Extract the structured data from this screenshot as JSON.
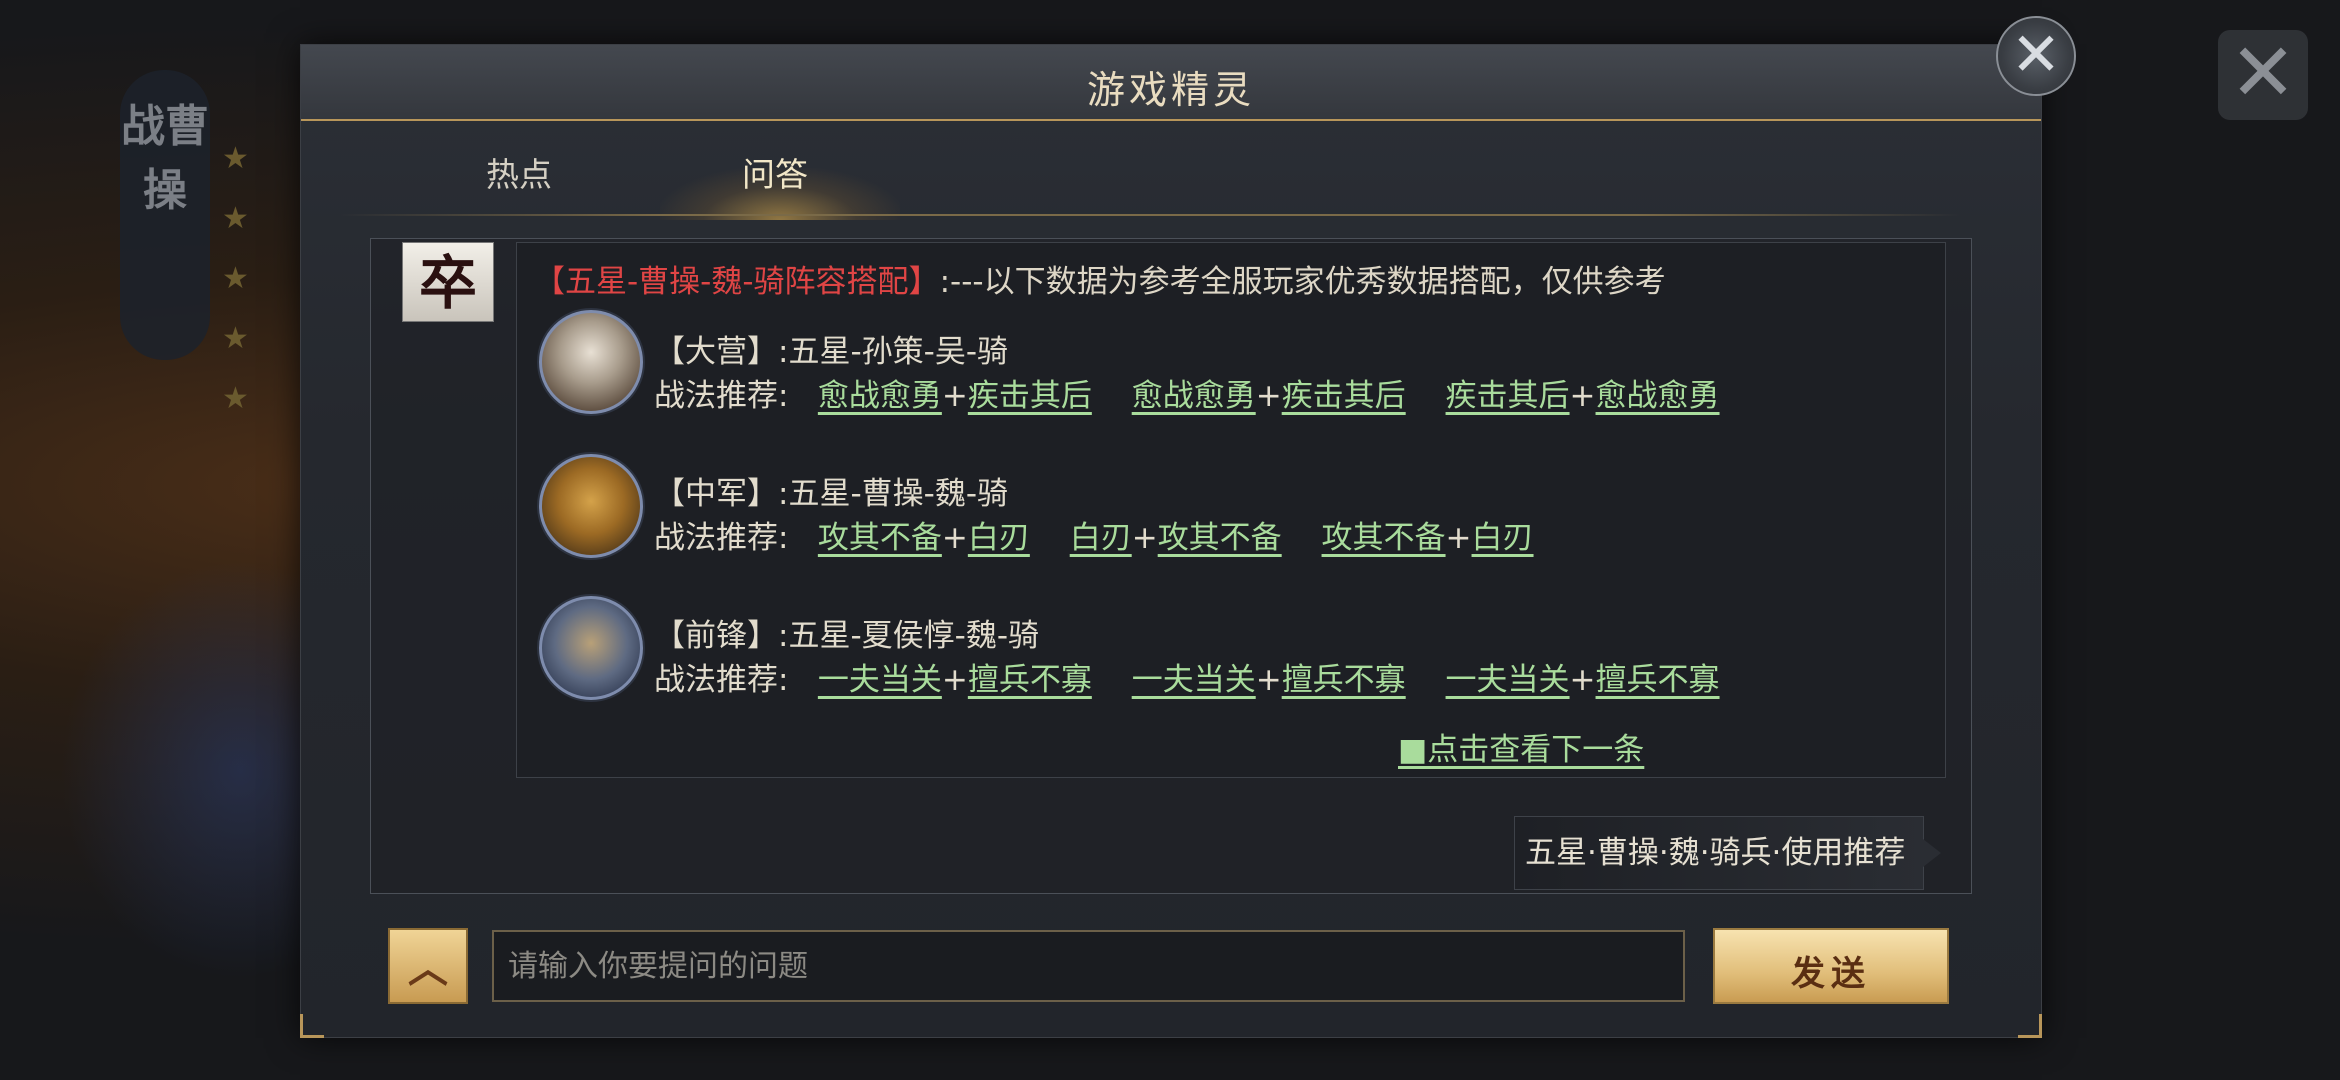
{
  "background": {
    "banner_text": "战曹操",
    "stars": [
      "★",
      "★",
      "★",
      "★",
      "★"
    ]
  },
  "dialog": {
    "title": "游戏精灵",
    "close_icon": "✕"
  },
  "tabs": [
    {
      "label": "热点",
      "active": false
    },
    {
      "label": "问答",
      "active": true
    }
  ],
  "message": {
    "bot_avatar_char": "卒",
    "headline_tag": "【五星-曹操-魏-骑阵容搭配】",
    "headline_rest": ":---以下数据为参考全服玩家优秀数据搭配，仅供参考",
    "heroes": [
      {
        "position": "【大营】:五星-孙策-吴-骑",
        "tactic_label": "战法推荐:",
        "combos": [
          [
            "愈战愈勇",
            "疾击其后"
          ],
          [
            "愈战愈勇",
            "疾击其后"
          ],
          [
            "疾击其后",
            "愈战愈勇"
          ]
        ]
      },
      {
        "position": "【中军】:五星-曹操-魏-骑",
        "tactic_label": "战法推荐:",
        "combos": [
          [
            "攻其不备",
            "白刃"
          ],
          [
            "白刃",
            "攻其不备"
          ],
          [
            "攻其不备",
            "白刃"
          ]
        ]
      },
      {
        "position": "【前锋】:五星-夏侯惇-魏-骑",
        "tactic_label": "战法推荐:",
        "combos": [
          [
            "一夫当关",
            "擅兵不寡"
          ],
          [
            "一夫当关",
            "擅兵不寡"
          ],
          [
            "一夫当关",
            "擅兵不寡"
          ]
        ]
      }
    ],
    "plus": "+",
    "next_link": "■点击查看下一条"
  },
  "suggestion": "五星·曹操·魏·骑兵·使用推荐",
  "input": {
    "placeholder": "请输入你要提问的问题",
    "value": ""
  },
  "buttons": {
    "up_icon": "︿",
    "send": "发送"
  },
  "colors": {
    "accent_gold": "#b8965a",
    "headline_red": "#e04545",
    "link_green": "#a9dc9c"
  }
}
